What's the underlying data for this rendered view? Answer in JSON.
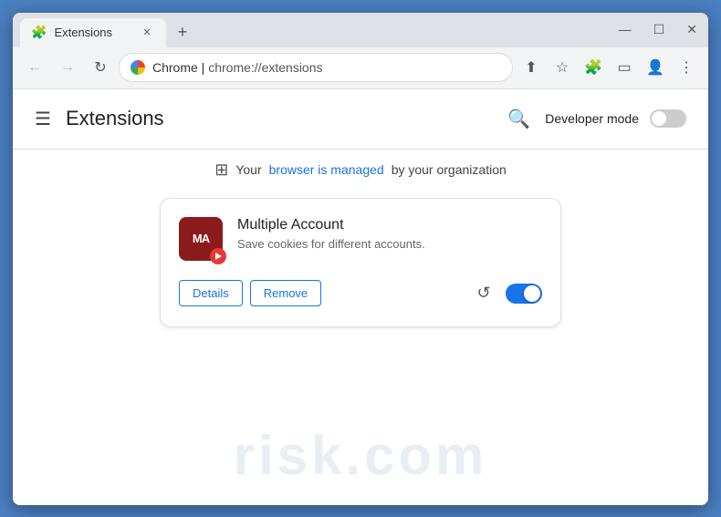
{
  "window": {
    "title": "Extensions",
    "tab_label": "Extensions",
    "close_symbol": "✕",
    "new_tab_symbol": "+",
    "minimize_symbol": "—",
    "maximize_symbol": "☐",
    "winclose_symbol": "✕"
  },
  "toolbar": {
    "back_label": "←",
    "forward_label": "→",
    "reload_label": "↻",
    "site_name": "Chrome",
    "url": "chrome://extensions",
    "share_icon": "⬆",
    "star_icon": "☆",
    "puzzle_icon": "🧩",
    "sidebar_icon": "▭",
    "account_icon": "👤",
    "menu_icon": "⋮"
  },
  "page": {
    "hamburger": "☰",
    "title": "Extensions",
    "search_icon": "🔍",
    "developer_mode_label": "Developer mode",
    "managed_icon": "⊞",
    "managed_text_before": "Your ",
    "managed_link": "browser is managed",
    "managed_text_after": " by your organization"
  },
  "extension": {
    "icon_text": "MA",
    "badge_icon": "●",
    "name": "Multiple Account",
    "description": "Save cookies for different accounts.",
    "details_label": "Details",
    "remove_label": "Remove",
    "reload_icon": "↺",
    "enabled": true
  },
  "watermark": {
    "text": "risk.com"
  }
}
